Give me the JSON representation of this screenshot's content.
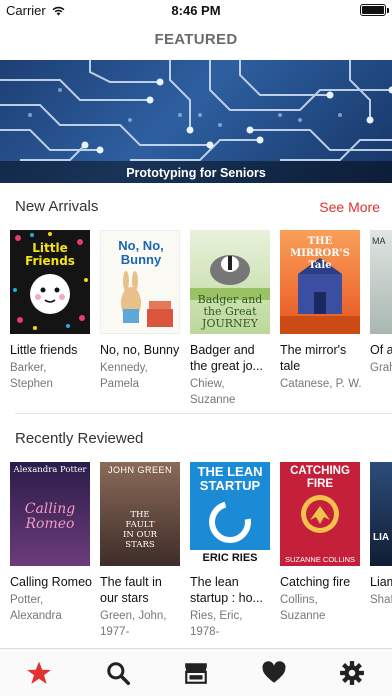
{
  "status_bar": {
    "carrier": "Carrier",
    "time": "8:46 PM",
    "battery_level": 1.0
  },
  "nav": {
    "title": "FEATURED"
  },
  "banner": {
    "caption": "Prototyping for Seniors"
  },
  "new_arrivals": {
    "header": "New Arrivals",
    "see_more": "See More",
    "books": [
      {
        "title": "Little friends",
        "author": "Barker, Stephen",
        "cover_color": "#111111",
        "cover_text": "Little Friends"
      },
      {
        "title": "No, no, Bunny",
        "author": "Kennedy, Pamela",
        "cover_color": "#ffffff",
        "cover_text": "No, No, Bunny"
      },
      {
        "title": "Badger and the great jo...",
        "author": "Chiew, Suzanne",
        "cover_color": "#cfe4b4",
        "cover_text": "Badger and the Great JOURNEY"
      },
      {
        "title": "The mirror's tale",
        "author": "Catanese, P. W.",
        "cover_color": "#f36f2a",
        "cover_text": "THE MIRROR'S Tale"
      },
      {
        "title": "Of a dust",
        "author": "Grah",
        "cover_color": "#ccd3cf",
        "cover_text": "MA"
      }
    ]
  },
  "recently_reviewed": {
    "header": "Recently Reviewed",
    "books": [
      {
        "title": "Calling Romeo",
        "author": "Potter, Alexandra",
        "cover_color": "#3a2560",
        "cover_text": "Calling Romeo",
        "cover_top": "Alexandra Potter"
      },
      {
        "title": "The fault in our stars",
        "author": "Green, John, 1977-",
        "cover_color": "#6e4a3a",
        "cover_text": "THE FAULT IN OUR STARS",
        "cover_top": "JOHN GREEN"
      },
      {
        "title": "The lean startup : ho...",
        "author": "Ries, Eric, 1978-",
        "cover_color": "#1c8bd6",
        "cover_text": "THE LEAN STARTUP",
        "cover_top": "ERIC RIES"
      },
      {
        "title": "Catching fire",
        "author": "Collins, Suzanne",
        "cover_color": "#c4203a",
        "cover_text": "CATCHING FIRE",
        "cover_top": "SUZANNE COLLINS"
      },
      {
        "title": "Liam Hem",
        "author": "Shaf Jens",
        "cover_color": "#2c4d7a",
        "cover_text": "LIA",
        "cover_top": ""
      }
    ]
  },
  "tabs": [
    {
      "name": "featured",
      "icon": "star-icon",
      "active": true
    },
    {
      "name": "search",
      "icon": "search-icon",
      "active": false
    },
    {
      "name": "library",
      "icon": "storefront-icon",
      "active": false
    },
    {
      "name": "favorites",
      "icon": "heart-icon",
      "active": false
    },
    {
      "name": "settings",
      "icon": "gear-icon",
      "active": false
    }
  ],
  "colors": {
    "accent": "#e0322e",
    "icon": "#222222"
  }
}
